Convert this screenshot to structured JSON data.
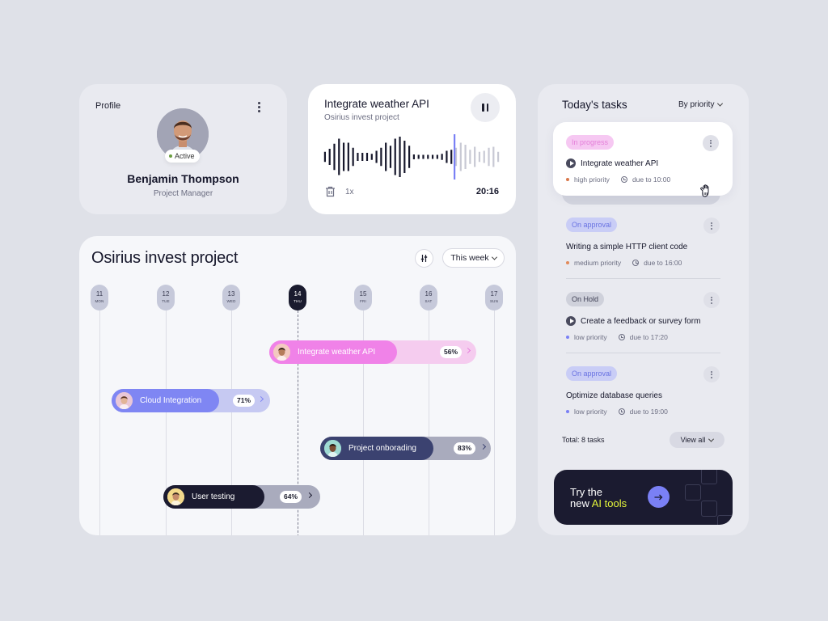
{
  "profile": {
    "title": "Profile",
    "name": "Benjamin Thompson",
    "role": "Project Manager",
    "status": "Active",
    "status_color": "#6a9e3f"
  },
  "audio": {
    "title": "Integrate weather API",
    "subtitle": "Osirius invest project",
    "speed": "1x",
    "time": "20:16",
    "playback_progress": 0.74,
    "waveform": [
      0.25,
      0.4,
      0.65,
      0.9,
      0.7,
      0.7,
      0.45,
      0.2,
      0.2,
      0.2,
      0.15,
      0.3,
      0.45,
      0.7,
      0.55,
      0.9,
      1.0,
      0.8,
      0.55,
      0.12,
      0.1,
      0.1,
      0.1,
      0.1,
      0.1,
      0.15,
      0.3,
      0.35,
      0.45,
      0.7,
      0.6,
      0.35,
      0.5,
      0.25,
      0.3,
      0.45,
      0.5,
      0.25
    ],
    "played_color": "#16172b",
    "unplayed_color": "#c8c9d4",
    "playhead_color": "#7a80f5"
  },
  "timeline": {
    "title": "Osirius invest project",
    "range_label": "This week",
    "days": [
      {
        "num": "11",
        "dow": "MON"
      },
      {
        "num": "12",
        "dow": "TUE"
      },
      {
        "num": "13",
        "dow": "WED"
      },
      {
        "num": "14",
        "dow": "THU",
        "today": true
      },
      {
        "num": "15",
        "dow": "FRI"
      },
      {
        "num": "16",
        "dow": "SAT"
      },
      {
        "num": "17",
        "dow": "SUN"
      }
    ],
    "tasks": [
      {
        "name": "Integrate weather API",
        "progress": "56%",
        "fill": "#f082e8",
        "track": "#f5ccef",
        "arrow": "#e77fdc"
      },
      {
        "name": "Cloud Integration",
        "progress": "71%",
        "fill": "#7f86f3",
        "track": "#c6c9f2",
        "arrow": "#7f86f3"
      },
      {
        "name": "Project onborading",
        "progress": "83%",
        "fill": "#3b4270",
        "track": "#a9abbd",
        "arrow": "#3b4270"
      },
      {
        "name": "User testing",
        "progress": "64%",
        "fill": "#1b1b30",
        "track": "#a9abbd",
        "arrow": "#1b1b30"
      }
    ]
  },
  "tasks_panel": {
    "title": "Today's tasks",
    "sort_label": "By priority",
    "items": [
      {
        "status": "In progress",
        "name": "Integrate weather API",
        "priority": "high priority",
        "priority_color": "#d9784b",
        "due": "due to 10:00",
        "playing": true
      },
      {
        "status": "On approval",
        "name": "Writing a simple HTTP client code",
        "priority": "medium priority",
        "priority_color": "#e28a5a",
        "due": "due to 16:00"
      },
      {
        "status": "On Hold",
        "name": "Create a feedback or survey form",
        "priority": "low priority",
        "priority_color": "#7a80f5",
        "due": "due to 17:20",
        "playing": true
      },
      {
        "status": "On approval",
        "name": "Optimize database queries",
        "priority": "low priority",
        "priority_color": "#7a80f5",
        "due": "due to 19:00"
      }
    ],
    "total": "Total: 8 tasks",
    "view_all": "View all",
    "promo_line1": "Try the",
    "promo_line2a": "new ",
    "promo_line2b": "AI tools"
  }
}
